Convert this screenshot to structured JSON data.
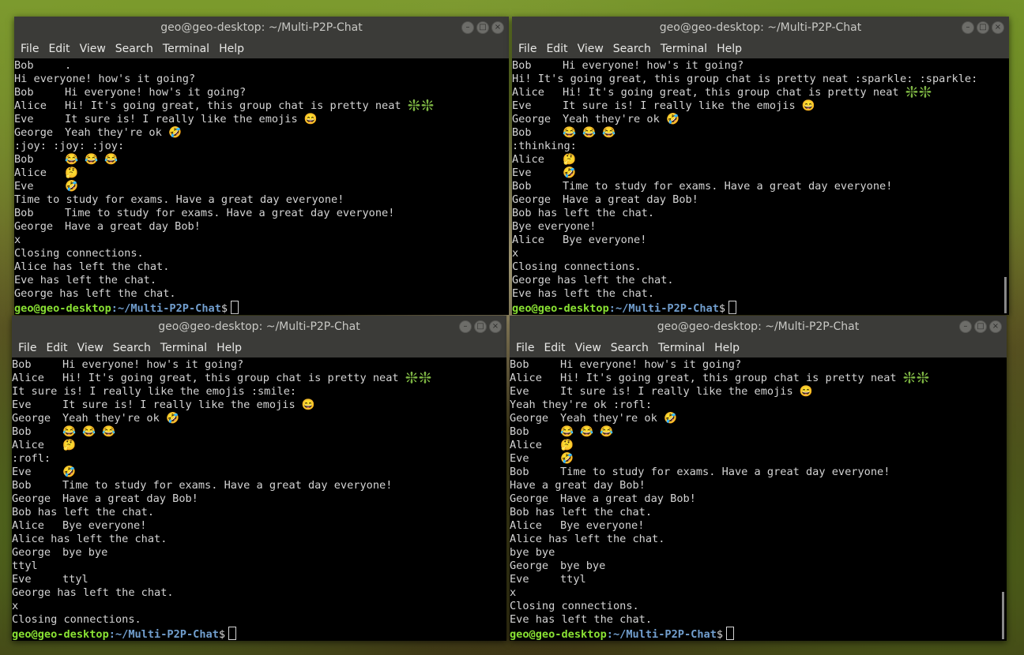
{
  "prompt": {
    "user": "geo@geo-desktop",
    "path": ":~/Multi-P2P-Chat",
    "symbol": "$"
  },
  "windows": [
    {
      "title": "geo@geo-desktop: ~/Multi-P2P-Chat",
      "menu": [
        "File",
        "Edit",
        "View",
        "Search",
        "Terminal",
        "Help"
      ],
      "lines": [
        {
          "name": "Bob",
          "text": "."
        },
        {
          "text": "Hi everyone! how's it going?"
        },
        {
          "name": "Bob",
          "text": "Hi everyone! how's it going?"
        },
        {
          "name": "Alice",
          "text": "Hi! It's going great, this group chat is pretty neat ❇️❇️"
        },
        {
          "name": "Eve",
          "text": "It sure is! I really like the emojis 😄"
        },
        {
          "name": "George",
          "text": "Yeah they're ok 🤣"
        },
        {
          "text": ":joy: :joy: :joy:"
        },
        {
          "name": "Bob",
          "text": "😂 😂 😂"
        },
        {
          "name": "Alice",
          "text": "🤔"
        },
        {
          "name": "Eve",
          "text": "🤣"
        },
        {
          "text": "Time to study for exams. Have a great day everyone!"
        },
        {
          "name": "Bob",
          "text": "Time to study for exams. Have a great day everyone!"
        },
        {
          "name": "George",
          "text": "Have a great day Bob!"
        },
        {
          "text": "x"
        },
        {
          "text": "Closing connections."
        },
        {
          "text": "Alice has left the chat."
        },
        {
          "text": "Eve has left the chat."
        },
        {
          "text": "George has left the chat."
        }
      ]
    },
    {
      "title": "geo@geo-desktop: ~/Multi-P2P-Chat",
      "menu": [
        "File",
        "Edit",
        "View",
        "Search",
        "Terminal",
        "Help"
      ],
      "lines": [
        {
          "name": "Bob",
          "text": "Hi everyone! how's it going?"
        },
        {
          "text": "Hi! It's going great, this group chat is pretty neat :sparkle: :sparkle:"
        },
        {
          "name": "Alice",
          "text": "Hi! It's going great, this group chat is pretty neat ❇️❇️"
        },
        {
          "name": "Eve",
          "text": "It sure is! I really like the emojis 😄"
        },
        {
          "name": "George",
          "text": "Yeah they're ok 🤣"
        },
        {
          "name": "Bob",
          "text": "😂 😂 😂"
        },
        {
          "text": ":thinking:"
        },
        {
          "name": "Alice",
          "text": "🤔"
        },
        {
          "name": "Eve",
          "text": "🤣"
        },
        {
          "name": "Bob",
          "text": "Time to study for exams. Have a great day everyone!"
        },
        {
          "name": "George",
          "text": "Have a great day Bob!"
        },
        {
          "text": "Bob has left the chat."
        },
        {
          "text": "Bye everyone!"
        },
        {
          "name": "Alice",
          "text": "Bye everyone!"
        },
        {
          "text": "x"
        },
        {
          "text": "Closing connections."
        },
        {
          "text": "George has left the chat."
        },
        {
          "text": "Eve has left the chat."
        }
      ]
    },
    {
      "title": "geo@geo-desktop: ~/Multi-P2P-Chat",
      "menu": [
        "File",
        "Edit",
        "View",
        "Search",
        "Terminal",
        "Help"
      ],
      "lines": [
        {
          "name": "Bob",
          "text": "Hi everyone! how's it going?"
        },
        {
          "name": "Alice",
          "text": "Hi! It's going great, this group chat is pretty neat ❇️❇️"
        },
        {
          "text": "It sure is! I really like the emojis :smile:"
        },
        {
          "name": "Eve",
          "text": "It sure is! I really like the emojis 😄"
        },
        {
          "name": "George",
          "text": "Yeah they're ok 🤣"
        },
        {
          "name": "Bob",
          "text": "😂 😂 😂"
        },
        {
          "name": "Alice",
          "text": "🤔"
        },
        {
          "text": ":rofl:"
        },
        {
          "name": "Eve",
          "text": "🤣"
        },
        {
          "name": "Bob",
          "text": "Time to study for exams. Have a great day everyone!"
        },
        {
          "name": "George",
          "text": "Have a great day Bob!"
        },
        {
          "text": "Bob has left the chat."
        },
        {
          "name": "Alice",
          "text": "Bye everyone!"
        },
        {
          "text": "Alice has left the chat."
        },
        {
          "name": "George",
          "text": "bye bye"
        },
        {
          "text": "ttyl"
        },
        {
          "name": "Eve",
          "text": "ttyl"
        },
        {
          "text": "George has left the chat."
        },
        {
          "text": "x"
        },
        {
          "text": "Closing connections."
        }
      ]
    },
    {
      "title": "geo@geo-desktop: ~/Multi-P2P-Chat",
      "menu": [
        "File",
        "Edit",
        "View",
        "Search",
        "Terminal",
        "Help"
      ],
      "lines": [
        {
          "name": "Bob",
          "text": "Hi everyone! how's it going?"
        },
        {
          "name": "Alice",
          "text": "Hi! It's going great, this group chat is pretty neat ❇️❇️"
        },
        {
          "name": "Eve",
          "text": "It sure is! I really like the emojis 😄"
        },
        {
          "text": "Yeah they're ok :rofl:"
        },
        {
          "name": "George",
          "text": "Yeah they're ok 🤣"
        },
        {
          "name": "Bob",
          "text": "😂 😂 😂"
        },
        {
          "name": "Alice",
          "text": "🤔"
        },
        {
          "name": "Eve",
          "text": "🤣"
        },
        {
          "name": "Bob",
          "text": "Time to study for exams. Have a great day everyone!"
        },
        {
          "text": "Have a great day Bob!"
        },
        {
          "name": "George",
          "text": "Have a great day Bob!"
        },
        {
          "text": "Bob has left the chat."
        },
        {
          "name": "Alice",
          "text": "Bye everyone!"
        },
        {
          "text": "Alice has left the chat."
        },
        {
          "text": "bye bye"
        },
        {
          "name": "George",
          "text": "bye bye"
        },
        {
          "name": "Eve",
          "text": "ttyl"
        },
        {
          "text": "x"
        },
        {
          "text": "Closing connections."
        },
        {
          "text": "Eve has left the chat."
        }
      ]
    }
  ]
}
